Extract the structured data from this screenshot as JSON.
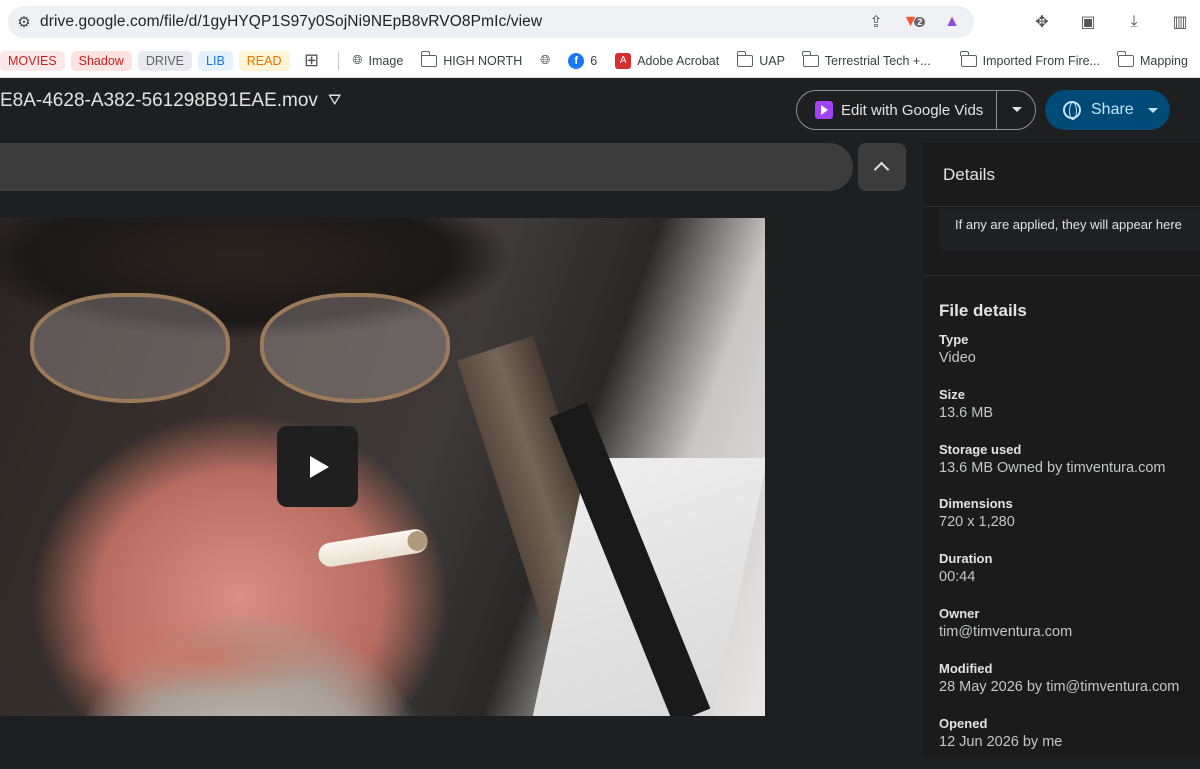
{
  "browser": {
    "url": "drive.google.com/file/d/1gyHYQP1S97y0SojNi9NEpB8vRVO8PmIc/view",
    "brave_badge": "2",
    "bookmarks": {
      "chips": [
        {
          "label": "MOVIES",
          "bg": "#fde7e9",
          "fg": "#c5221f"
        },
        {
          "label": "Shadow",
          "bg": "#fde2e2",
          "fg": "#c5221f"
        },
        {
          "label": "DRIVE",
          "bg": "#e8eaed",
          "fg": "#5f6368"
        },
        {
          "label": "LIB",
          "bg": "#e3f2fd",
          "fg": "#1a73e8"
        },
        {
          "label": "READ",
          "bg": "#fff4d6",
          "fg": "#e37400"
        }
      ],
      "items": [
        {
          "label": "Image",
          "icon": "globe-icon"
        },
        {
          "label": "HIGH NORTH",
          "icon": "folder-icon"
        },
        {
          "label": "",
          "icon": "globe-icon"
        },
        {
          "label": "6",
          "icon": "facebook-icon"
        },
        {
          "label": "Adobe Acrobat",
          "icon": "acrobat-icon"
        },
        {
          "label": "UAP",
          "icon": "folder-icon"
        },
        {
          "label": "Terrestrial Tech +...",
          "icon": "folder-icon"
        },
        {
          "label": "Imported From Fire...",
          "icon": "folder-icon"
        },
        {
          "label": "Mapping",
          "icon": "folder-icon"
        }
      ]
    }
  },
  "viewer": {
    "file_name": "E8A-4628-A382-561298B91EAE.mov",
    "edit_button": "Edit with Google Vids",
    "share_button": "Share"
  },
  "details": {
    "title": "Details",
    "labels_note": "If any are applied, they will appear here",
    "file_details_title": "File details",
    "rows": [
      {
        "label": "Type",
        "value": "Video"
      },
      {
        "label": "Size",
        "value": "13.6 MB"
      },
      {
        "label": "Storage used",
        "value": "13.6 MB Owned by timventura.com"
      },
      {
        "label": "Dimensions",
        "value": "720 x 1,280"
      },
      {
        "label": "Duration",
        "value": "00:44"
      },
      {
        "label": "Owner",
        "value": "tim@timventura.com"
      },
      {
        "label": "Modified",
        "value": "28 May 2026 by tim@timventura.com"
      },
      {
        "label": "Opened",
        "value": "12 Jun 2026 by me"
      }
    ]
  }
}
